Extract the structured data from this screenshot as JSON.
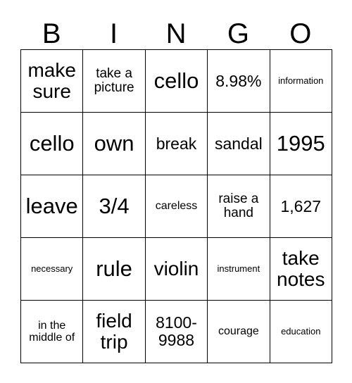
{
  "card": {
    "header": {
      "letters": [
        "B",
        "I",
        "N",
        "G",
        "O"
      ]
    },
    "rows": [
      [
        {
          "text": "make sure",
          "size": "lg"
        },
        {
          "text": "take a picture",
          "size": "sm"
        },
        {
          "text": "cello",
          "size": "xl"
        },
        {
          "text": "8.98%",
          "size": "md"
        },
        {
          "text": "information",
          "size": "xxs"
        }
      ],
      [
        {
          "text": "cello",
          "size": "xl"
        },
        {
          "text": "own",
          "size": "xl"
        },
        {
          "text": "break",
          "size": "md"
        },
        {
          "text": "sandal",
          "size": "md"
        },
        {
          "text": "1995",
          "size": "xl"
        }
      ],
      [
        {
          "text": "leave",
          "size": "xl"
        },
        {
          "text": "3/4",
          "size": "xl"
        },
        {
          "text": "careless",
          "size": "xs"
        },
        {
          "text": "raise a hand",
          "size": "sm"
        },
        {
          "text": "1,627",
          "size": "md"
        }
      ],
      [
        {
          "text": "necessary",
          "size": "xxs"
        },
        {
          "text": "rule",
          "size": "xl"
        },
        {
          "text": "violin",
          "size": "lg"
        },
        {
          "text": "instrument",
          "size": "xxs"
        },
        {
          "text": "take notes",
          "size": "lg"
        }
      ],
      [
        {
          "text": "in the middle of",
          "size": "xs"
        },
        {
          "text": "field trip",
          "size": "lg"
        },
        {
          "text": "8100-9988",
          "size": "md"
        },
        {
          "text": "courage",
          "size": "xs"
        },
        {
          "text": "education",
          "size": "xxs"
        }
      ]
    ]
  }
}
